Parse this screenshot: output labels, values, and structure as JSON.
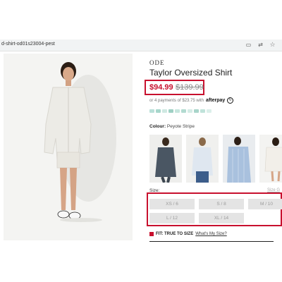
{
  "browser": {
    "url": "d-shirt-od01s23004-pest",
    "icons": [
      "cast-icon",
      "translate-icon",
      "star-icon"
    ]
  },
  "product": {
    "brand": "ODE",
    "title": "Taylor Oversized Shirt",
    "price_sale": "$94.99",
    "price_original": "$139.99",
    "installments_text": "or 4 payments of $23.75 with",
    "installments_provider": "afterpay",
    "colour_label": "Colour:",
    "colour_value": "Peyote Stripe",
    "size_label": "Size:",
    "size_guide": "Size G",
    "sizes": [
      "XS / 6",
      "S / 8",
      "M / 10",
      "L / 12",
      "XL / 14"
    ],
    "fit_label": "FIT: TRUE TO SIZE",
    "fit_link": "What's My Size?"
  },
  "colors": {
    "accent_red": "#c8102e",
    "swatches": [
      "#b9e0d8",
      "#a7d6cb",
      "#cfe9e2",
      "#9fd0c4",
      "#c7e6de",
      "#b3dbd1",
      "#d5ece6",
      "#a9d5ca",
      "#c0e3da",
      "#dbefea"
    ]
  }
}
